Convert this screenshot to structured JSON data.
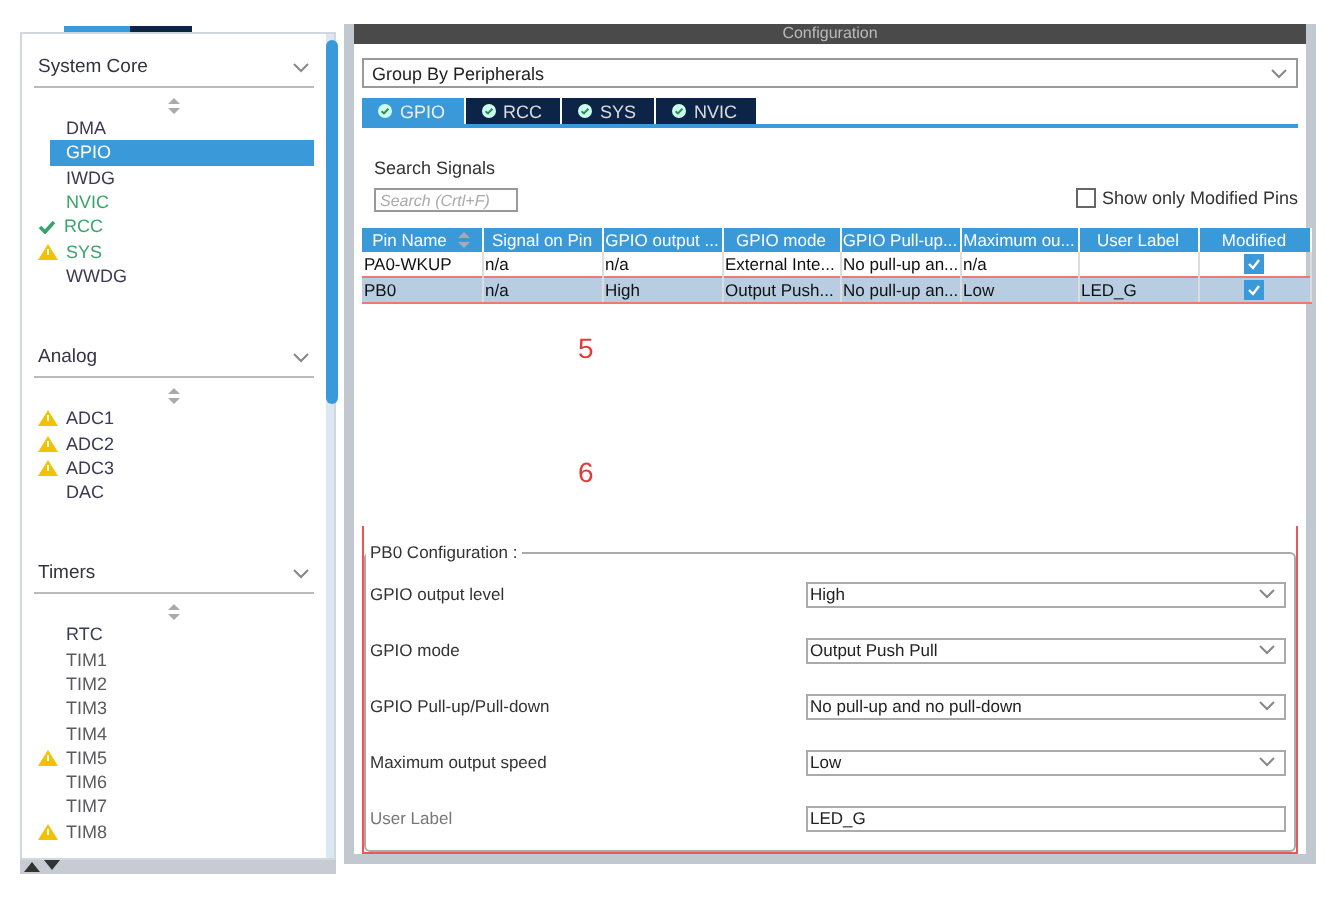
{
  "sidebar": {
    "sections": [
      {
        "title": "System Core",
        "items": [
          {
            "label": "DMA",
            "kind": "plain",
            "color": "#3a3a55",
            "selected": false
          },
          {
            "label": "GPIO",
            "kind": "plain",
            "selected": true
          },
          {
            "label": "IWDG",
            "kind": "plain",
            "color": "#3a3a55",
            "selected": false
          },
          {
            "label": "NVIC",
            "kind": "plain",
            "color": "#3aa56a",
            "selected": false
          },
          {
            "label": "RCC",
            "kind": "check",
            "color": "#3aa56a",
            "selected": false
          },
          {
            "label": "SYS",
            "kind": "warning",
            "color": "#3aa56a",
            "selected": false
          },
          {
            "label": "WWDG",
            "kind": "plain",
            "color": "#3a3a55",
            "selected": false
          }
        ]
      },
      {
        "title": "Analog",
        "items": [
          {
            "label": "ADC1",
            "kind": "warning",
            "color": "#3a3a55",
            "selected": false
          },
          {
            "label": "ADC2",
            "kind": "warning",
            "color": "#3a3a55",
            "selected": false
          },
          {
            "label": "ADC3",
            "kind": "warning",
            "color": "#3a3a55",
            "selected": false
          },
          {
            "label": "DAC",
            "kind": "plain",
            "color": "#3a3a55",
            "selected": false
          }
        ]
      },
      {
        "title": "Timers",
        "items": [
          {
            "label": "RTC",
            "kind": "plain",
            "color": "#3a3a55",
            "selected": false
          },
          {
            "label": "TIM1",
            "kind": "plain",
            "color": "#5a5a60",
            "selected": false
          },
          {
            "label": "TIM2",
            "kind": "plain",
            "color": "#5a5a60",
            "selected": false
          },
          {
            "label": "TIM3",
            "kind": "plain",
            "color": "#5a5a60",
            "selected": false
          },
          {
            "label": "TIM4",
            "kind": "plain",
            "color": "#5a5a60",
            "selected": false
          },
          {
            "label": "TIM5",
            "kind": "warning",
            "color": "#5a5a60",
            "selected": false
          },
          {
            "label": "TIM6",
            "kind": "plain",
            "color": "#5a5a60",
            "selected": false
          },
          {
            "label": "TIM7",
            "kind": "plain",
            "color": "#5a5a60",
            "selected": false
          },
          {
            "label": "TIM8",
            "kind": "warning",
            "color": "#5a5a60",
            "selected": false
          }
        ]
      }
    ]
  },
  "configuration": {
    "title": "Configuration",
    "group_by": "Group By Peripherals",
    "tabs": [
      {
        "label": "GPIO",
        "selected": true
      },
      {
        "label": "RCC",
        "selected": false
      },
      {
        "label": "SYS",
        "selected": false
      },
      {
        "label": "NVIC",
        "selected": false
      }
    ],
    "search_label": "Search Signals",
    "search": {
      "placeholder": "Search (Crtl+F)"
    },
    "show_modified": {
      "label": "Show only Modified Pins",
      "checked": false
    },
    "table": {
      "columns": [
        "Pin Name",
        "Signal on Pin",
        "GPIO output ...",
        "GPIO mode",
        "GPIO Pull-up...",
        "Maximum ou...",
        "User Label",
        "Modified"
      ],
      "rows": [
        {
          "cells": [
            "PA0-WKUP",
            "n/a",
            "n/a",
            "External Inte...",
            "No pull-up an...",
            "n/a",
            ""
          ],
          "modified": true,
          "selected": false
        },
        {
          "cells": [
            "PB0",
            "n/a",
            "High",
            "Output Push...",
            "No pull-up an...",
            "Low",
            "LED_G"
          ],
          "modified": true,
          "selected": true
        }
      ]
    },
    "annotations": [
      "5",
      "6"
    ],
    "pin_config": {
      "title": "PB0 Configuration :",
      "fields": [
        {
          "label": "GPIO output level",
          "value": "High",
          "kind": "dropdown"
        },
        {
          "label": "GPIO mode",
          "value": "Output Push Pull",
          "kind": "dropdown"
        },
        {
          "label": "GPIO Pull-up/Pull-down",
          "value": "No pull-up and no pull-down",
          "kind": "dropdown"
        },
        {
          "label": "Maximum output speed",
          "value": "Low",
          "kind": "dropdown"
        },
        {
          "label": "User Label",
          "value": "LED_G",
          "kind": "text"
        }
      ]
    }
  }
}
